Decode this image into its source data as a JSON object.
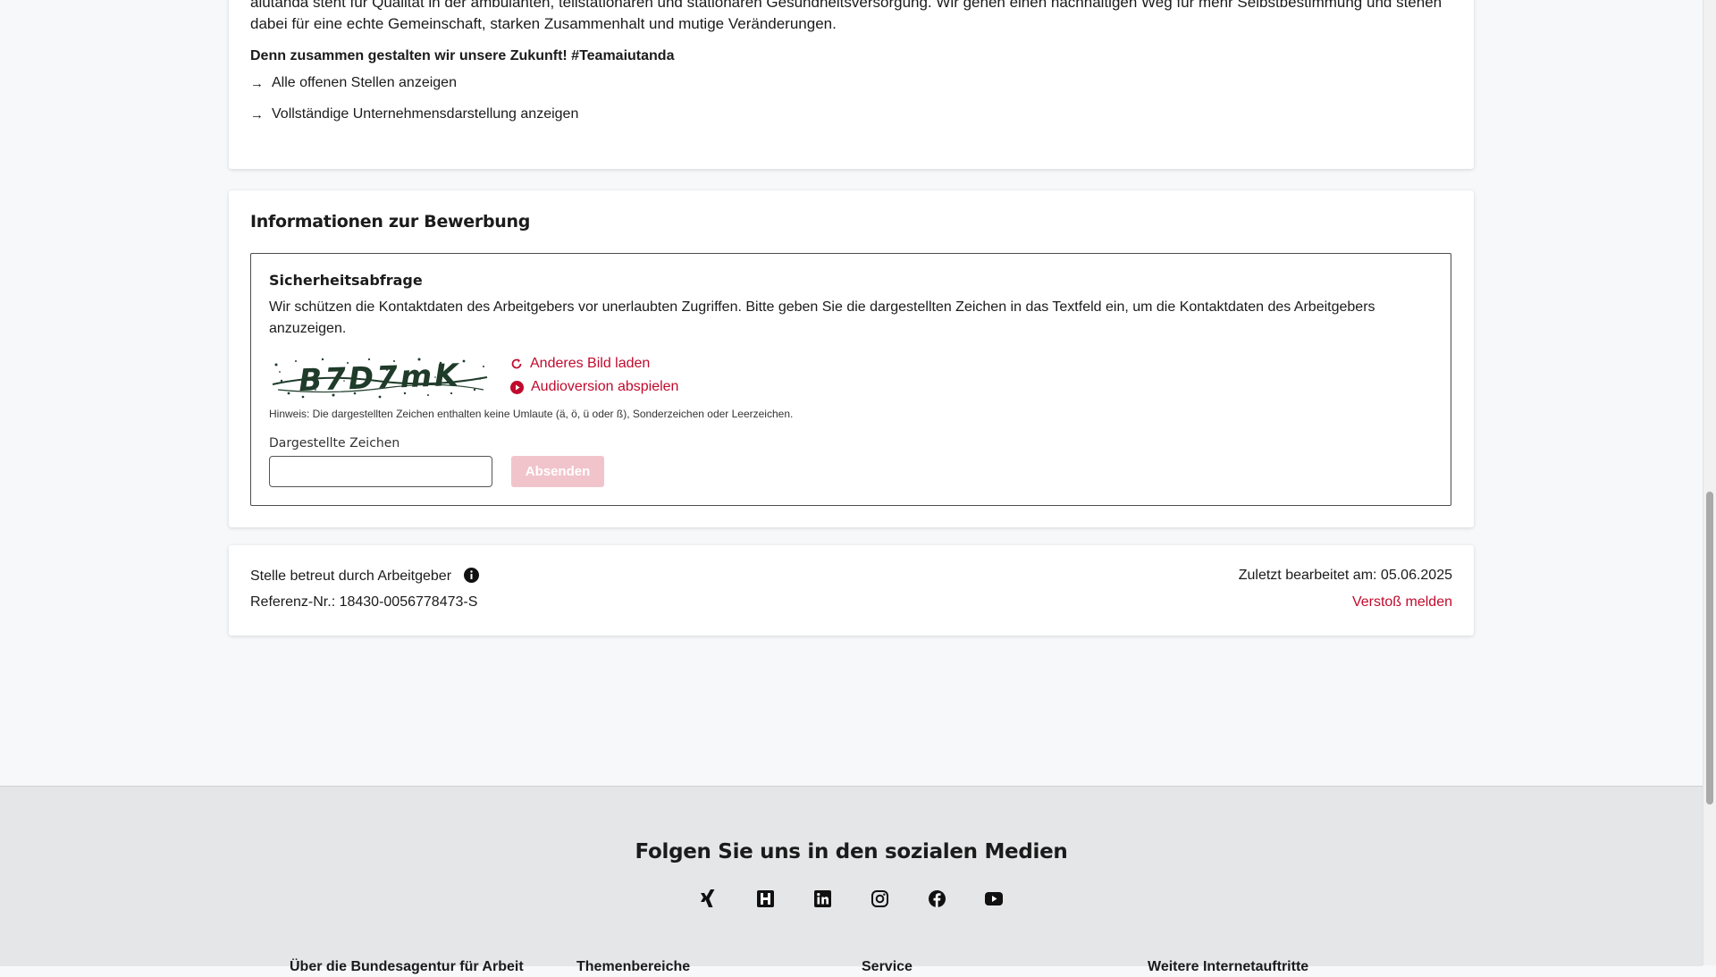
{
  "company": {
    "intro": "aiutanda steht für Qualität in der ambulanten, teilstationären und stationären Gesundheitsversorgung. Wir gehen einen nachhaltigen Weg für mehr Selbstbestimmung und stehen dabei für eine echte Gemeinschaft, starken Zusammenhalt und mutige Veränderungen.",
    "slogan": "Denn zusammen gestalten wir unsere Zukunft! #Teamaiutanda",
    "links": [
      {
        "label": "Alle offenen Stellen anzeigen",
        "icon": "arrow-right-icon"
      },
      {
        "label": "Vollständige Unternehmensdarstellung anzeigen",
        "icon": "arrow-right-icon"
      }
    ]
  },
  "application": {
    "title": "Informationen zur Bewerbung",
    "captcha": {
      "title": "Sicherheitsabfrage",
      "description": "Wir schützen die Kontaktdaten des Arbeitgebers vor unerlaubten Zugriffen. Bitte geben Sie die dargestellten Zeichen in das Textfeld ein, um die Kontaktdaten des Arbeitgebers anzuzeigen.",
      "image_text": "B7D7mK",
      "reload_label": "Anderes Bild laden",
      "audio_label": "Audioversion abspielen",
      "hint": "Hinweis: Die dargestellten Zeichen enthalten keine Umlaute (ä, ö, ü oder ß), Sonderzeichen oder Leerzeichen.",
      "field_label": "Dargestellte Zeichen",
      "field_value": "",
      "submit_label": "Absenden"
    }
  },
  "meta": {
    "managed_by": "Stelle betreut durch Arbeitgeber",
    "reference": "Referenz-Nr.: 18430-0056778473-S",
    "last_edited": "Zuletzt bearbeitet am: 05.06.2025",
    "report_label": "Verstoß melden"
  },
  "footer": {
    "social_title": "Folgen Sie uns in den sozialen Medien",
    "social_icons": [
      "xing-icon",
      "kununu-icon",
      "linkedin-icon",
      "instagram-icon",
      "facebook-icon",
      "youtube-icon"
    ],
    "columns": [
      "Über die Bundesagentur für Arbeit",
      "Themenbereiche",
      "Service",
      "Weitere Internetauftritte"
    ]
  },
  "colors": {
    "accent": "#c00a2d",
    "button_disabled": "#f1c4cc",
    "background": "#f7f8fa",
    "footer_bg": "#e5e6e8"
  }
}
